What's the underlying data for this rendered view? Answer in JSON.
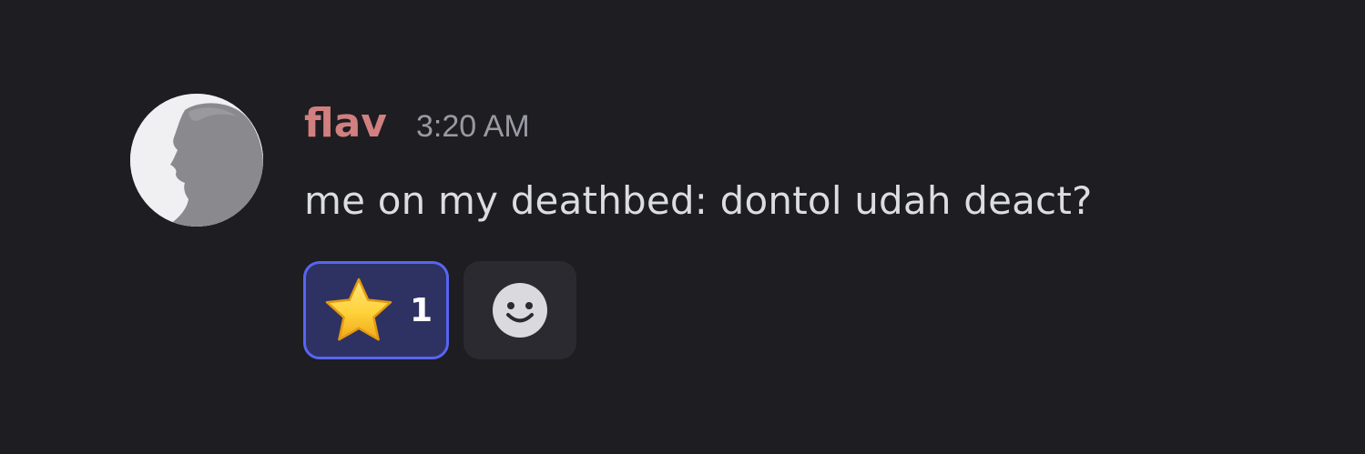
{
  "message": {
    "author": "flav",
    "timestamp": "3:20 AM",
    "text": "me on my deathbed: dontol udah deact?",
    "author_color": "#d17f7f"
  },
  "reactions": [
    {
      "emoji": "star",
      "count": "1",
      "reacted": true
    }
  ],
  "add_reaction_icon": "smiley-face-icon",
  "colors": {
    "background": "#1d1d22",
    "accent": "#5865f2",
    "reaction_bg": "#2e3262"
  }
}
